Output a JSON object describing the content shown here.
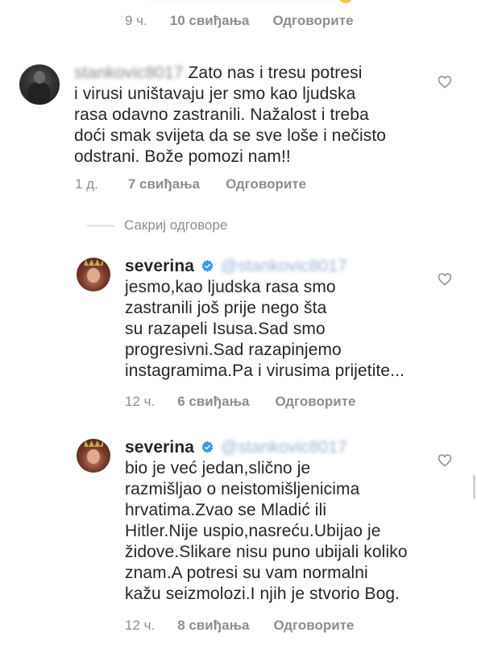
{
  "top_comment_meta": {
    "time": "9 ч.",
    "likes": "10 свиђања",
    "reply": "Одговорите"
  },
  "comment1": {
    "username": "stankovic8017",
    "lines": [
      "Zato nas i tresu potresi",
      "i virusi uništavaju jer smo kao ljudska",
      "rasa odavno zastranili. Nažalost i treba",
      "doći smak svijeta da se sve loše i nečisto",
      "odstrani. Bože pomozi nam!!"
    ],
    "time": "1 д.",
    "likes": "7 свиђања",
    "reply": "Одговорите"
  },
  "hide_replies_label": "Сакриј одговоре",
  "reply1": {
    "username": "severina",
    "mention": "@stankovic8017",
    "lines": [
      "jesmo,kao ljudska rasa smo",
      "zastranili još prije nego šta",
      "su razapeli Isusa.Sad smo",
      "progresivni.Sad razapinjemo",
      "instagramima.Pa i virusima prijetite..."
    ],
    "time": "12 ч.",
    "likes": "6 свиђања",
    "reply": "Одговорите"
  },
  "reply2": {
    "username": "severina",
    "mention": "@stankovic8017",
    "lines": [
      "bio je već jedan,slično je",
      "razmišljao o neistomišljenicima",
      "hrvatima.Zvao se Mladić ili",
      "Hitler.Nije uspio,nasreću.Ubijao je",
      "židove.Slikare nisu puno ubijali koliko",
      "znam.A potresi su vam normalni",
      "kažu seizmolozi.I njih je stvorio Bog."
    ],
    "time": "12 ч.",
    "likes": "8 свиђања",
    "reply": "Одговорите"
  },
  "colors": {
    "text": "#262626",
    "secondary": "#8e8e8e",
    "verified": "#3897f0"
  }
}
